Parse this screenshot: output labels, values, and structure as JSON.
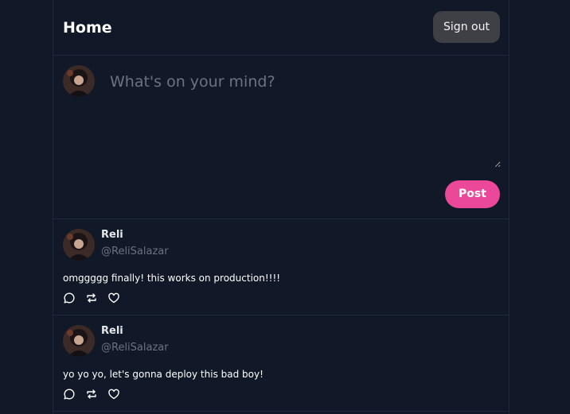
{
  "header": {
    "title": "Home",
    "signout_label": "Sign out"
  },
  "compose": {
    "placeholder": "What's on your mind?",
    "post_label": "Post"
  },
  "posts": [
    {
      "name": "Reli",
      "handle": "@ReliSalazar",
      "text": "omggggg finally! this works on production!!!!"
    },
    {
      "name": "Reli",
      "handle": "@ReliSalazar",
      "text": "yo yo yo, let's gonna deploy this bad boy!"
    }
  ],
  "icons": {
    "comment": "comment-icon",
    "retweet": "retweet-icon",
    "like": "heart-icon"
  },
  "colors": {
    "background": "#111827",
    "border": "#1e293b",
    "accent": "#ec4899",
    "signout_bg": "#3f3f46",
    "muted": "#6b7280"
  }
}
